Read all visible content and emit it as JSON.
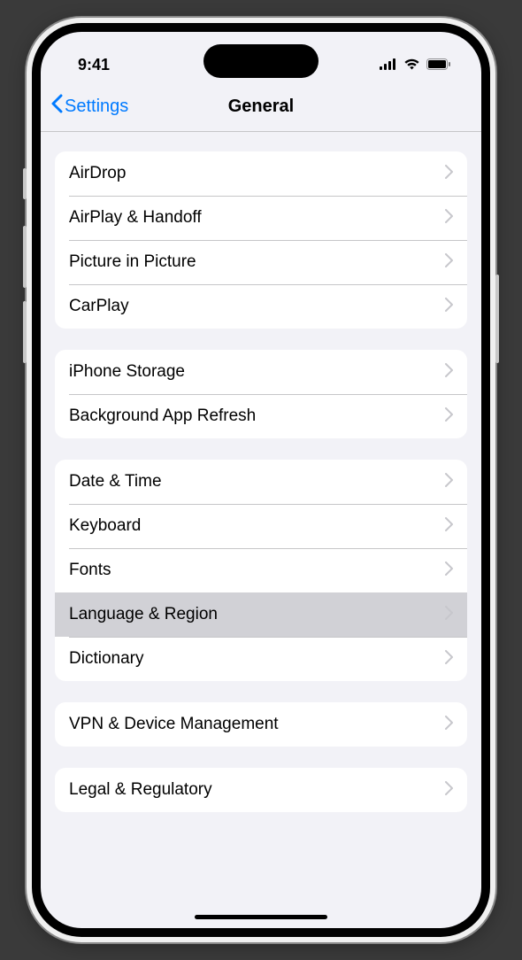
{
  "statusBar": {
    "time": "9:41"
  },
  "nav": {
    "back": "Settings",
    "title": "General"
  },
  "groups": [
    {
      "rows": [
        {
          "id": "airdrop",
          "label": "AirDrop"
        },
        {
          "id": "airplay",
          "label": "AirPlay & Handoff"
        },
        {
          "id": "pip",
          "label": "Picture in Picture"
        },
        {
          "id": "carplay",
          "label": "CarPlay"
        }
      ]
    },
    {
      "rows": [
        {
          "id": "storage",
          "label": "iPhone Storage"
        },
        {
          "id": "background-refresh",
          "label": "Background App Refresh"
        }
      ]
    },
    {
      "rows": [
        {
          "id": "date-time",
          "label": "Date & Time"
        },
        {
          "id": "keyboard",
          "label": "Keyboard"
        },
        {
          "id": "fonts",
          "label": "Fonts"
        },
        {
          "id": "language-region",
          "label": "Language & Region",
          "highlighted": true
        },
        {
          "id": "dictionary",
          "label": "Dictionary"
        }
      ]
    },
    {
      "rows": [
        {
          "id": "vpn",
          "label": "VPN & Device Management"
        }
      ]
    },
    {
      "rows": [
        {
          "id": "legal",
          "label": "Legal & Regulatory"
        }
      ]
    }
  ]
}
